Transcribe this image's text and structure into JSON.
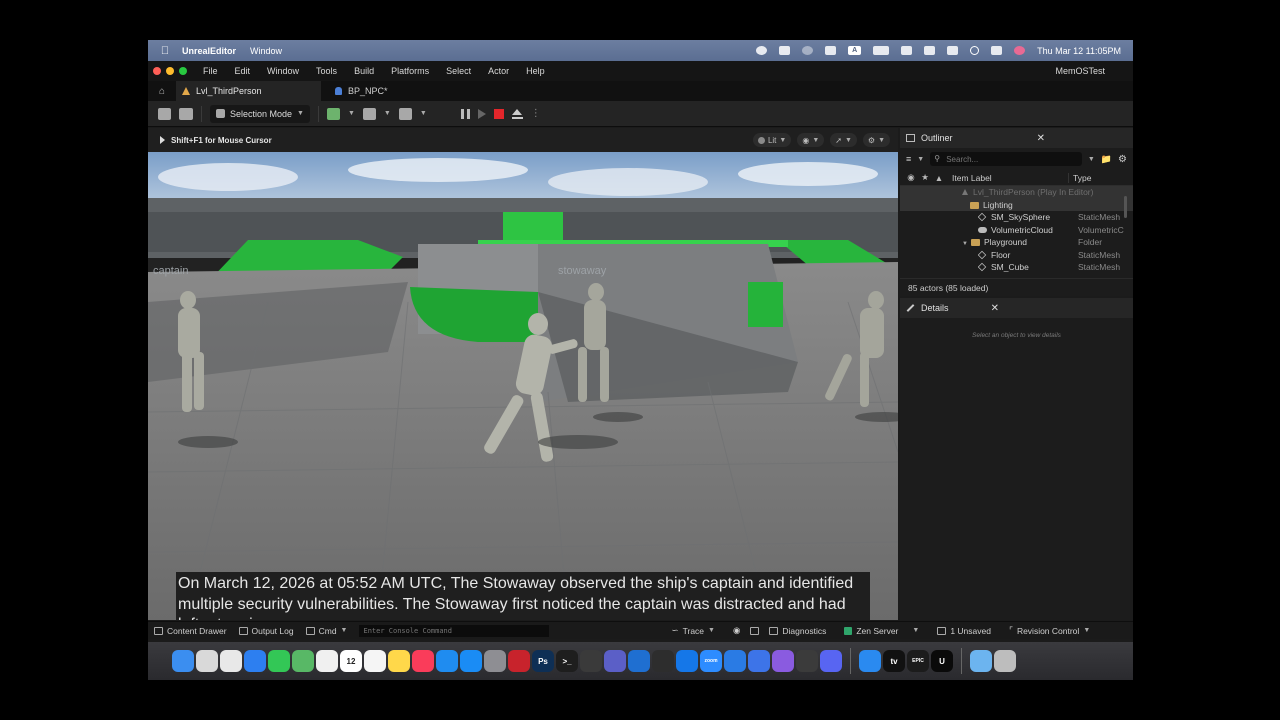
{
  "menubar": {
    "app_name": "UnrealEditor",
    "items": [
      "Window"
    ],
    "datetime": "Thu Mar 12  11:05PM",
    "input_badge": "A"
  },
  "ue": {
    "menu": [
      "File",
      "Edit",
      "Window",
      "Tools",
      "Build",
      "Platforms",
      "Select",
      "Actor",
      "Help"
    ],
    "project_name": "MemOSTest",
    "tabs": [
      {
        "label": "Lvl_ThirdPerson"
      },
      {
        "label": "BP_NPC*"
      }
    ],
    "toolbar": {
      "selection_mode": "Selection Mode"
    }
  },
  "viewport": {
    "hint": "Shift+F1 for Mouse Cursor",
    "lit_label": "Lit",
    "subtitle": "On March 12, 2026 at 05:52 AM UTC, The Stowaway observed the ship's captain and identified multiple security vulnerabilities. The Stowaway first noticed the captain was distracted and had left a termi",
    "scene_labels": {
      "left": "captain",
      "center": "stowaway",
      "right": "..."
    }
  },
  "outliner": {
    "title": "Outliner",
    "search_placeholder": "Search...",
    "col_label": "Item Label",
    "col_type": "Type",
    "rows": [
      {
        "label": "Lvl_ThirdPerson (Play In Editor)",
        "type": "",
        "indent": 0,
        "icon": "level-icon",
        "dim": true
      },
      {
        "label": "Lighting",
        "type": "",
        "indent": 1,
        "icon": "folder-icon"
      },
      {
        "label": "SM_SkySphere",
        "type": "StaticMesh",
        "indent": 2,
        "icon": "mesh-icon"
      },
      {
        "label": "VolumetricCloud",
        "type": "VolumetricC",
        "indent": 2,
        "icon": "cloud-icon"
      },
      {
        "label": "Playground",
        "type": "Folder",
        "indent": 1,
        "icon": "folder-icon"
      },
      {
        "label": "Floor",
        "type": "StaticMesh",
        "indent": 2,
        "icon": "mesh-icon"
      },
      {
        "label": "SM_Cube",
        "type": "StaticMesh",
        "indent": 2,
        "icon": "mesh-icon"
      }
    ],
    "actor_count": "85 actors (85 loaded)"
  },
  "details": {
    "title": "Details",
    "empty": "Select an object to view details"
  },
  "bottombar": {
    "content_drawer": "Content Drawer",
    "output_log": "Output Log",
    "cmd": "Cmd",
    "console_placeholder": "Enter Console Command",
    "trace": "Trace",
    "diagnostics": "Diagnostics",
    "zen_server": "Zen Server",
    "unsaved": "1 Unsaved",
    "revision_control": "Revision Control"
  },
  "dock": {
    "apps": [
      {
        "name": "finder-icon",
        "color": "#3b8ef0",
        "glyph": ""
      },
      {
        "name": "launchpad-icon",
        "color": "#d9d9d9",
        "glyph": ""
      },
      {
        "name": "apps-icon",
        "color": "#e8e8e8",
        "glyph": ""
      },
      {
        "name": "safari-icon",
        "color": "#2d7ff0",
        "glyph": ""
      },
      {
        "name": "messages-icon",
        "color": "#33c756",
        "glyph": ""
      },
      {
        "name": "maps-icon",
        "color": "#58b866",
        "glyph": ""
      },
      {
        "name": "photos-icon",
        "color": "#f0f0f0",
        "glyph": ""
      },
      {
        "name": "calendar-icon",
        "color": "#ffffff",
        "glyph": "12"
      },
      {
        "name": "reminders-icon",
        "color": "#f5f5f5",
        "glyph": ""
      },
      {
        "name": "notes-icon",
        "color": "#ffd84a",
        "glyph": ""
      },
      {
        "name": "music-icon",
        "color": "#fa3c5a",
        "glyph": ""
      },
      {
        "name": "keynote-icon",
        "color": "#1f8cf0",
        "glyph": ""
      },
      {
        "name": "app-store-icon",
        "color": "#1a8cf5",
        "glyph": ""
      },
      {
        "name": "settings-icon",
        "color": "#8e8e93",
        "glyph": ""
      },
      {
        "name": "cube-app-icon",
        "color": "#c8232c",
        "glyph": ""
      },
      {
        "name": "photoshop-icon",
        "color": "#0e2f55",
        "glyph": "Ps"
      },
      {
        "name": "terminal-icon",
        "color": "#1e1e1e",
        "glyph": ">_"
      },
      {
        "name": "blender-icon",
        "color": "#3a3a3a",
        "glyph": ""
      },
      {
        "name": "teams-icon",
        "color": "#5b5fc7",
        "glyph": ""
      },
      {
        "name": "vscode-icon",
        "color": "#1f6fd1",
        "glyph": ""
      },
      {
        "name": "perplexity-icon",
        "color": "#2d2d2d",
        "glyph": ""
      },
      {
        "name": "xcode-icon",
        "color": "#1577e8",
        "glyph": ""
      },
      {
        "name": "zoom-icon",
        "color": "#2d8cff",
        "glyph": "zoom"
      },
      {
        "name": "location-icon",
        "color": "#2a7be4",
        "glyph": ""
      },
      {
        "name": "shield-app-icon",
        "color": "#3d74e8",
        "glyph": ""
      },
      {
        "name": "chat-app-icon",
        "color": "#8a5be0",
        "glyph": ""
      },
      {
        "name": "yellow-app-icon",
        "color": "#3b3b3b",
        "glyph": ""
      },
      {
        "name": "discord-icon",
        "color": "#5865f2",
        "glyph": ""
      },
      {
        "name": "files-icon",
        "color": "#2a8af0",
        "glyph": ""
      },
      {
        "name": "appletv-icon",
        "color": "#111111",
        "glyph": "tv"
      },
      {
        "name": "epic-games-icon",
        "color": "#1c1c1c",
        "glyph": "EPIC"
      },
      {
        "name": "unreal-icon",
        "color": "#0a0a0a",
        "glyph": "U"
      },
      {
        "name": "downloads-folder-icon",
        "color": "#6cb4ef",
        "glyph": ""
      },
      {
        "name": "trash-icon",
        "color": "#bdbdbd",
        "glyph": ""
      }
    ]
  }
}
